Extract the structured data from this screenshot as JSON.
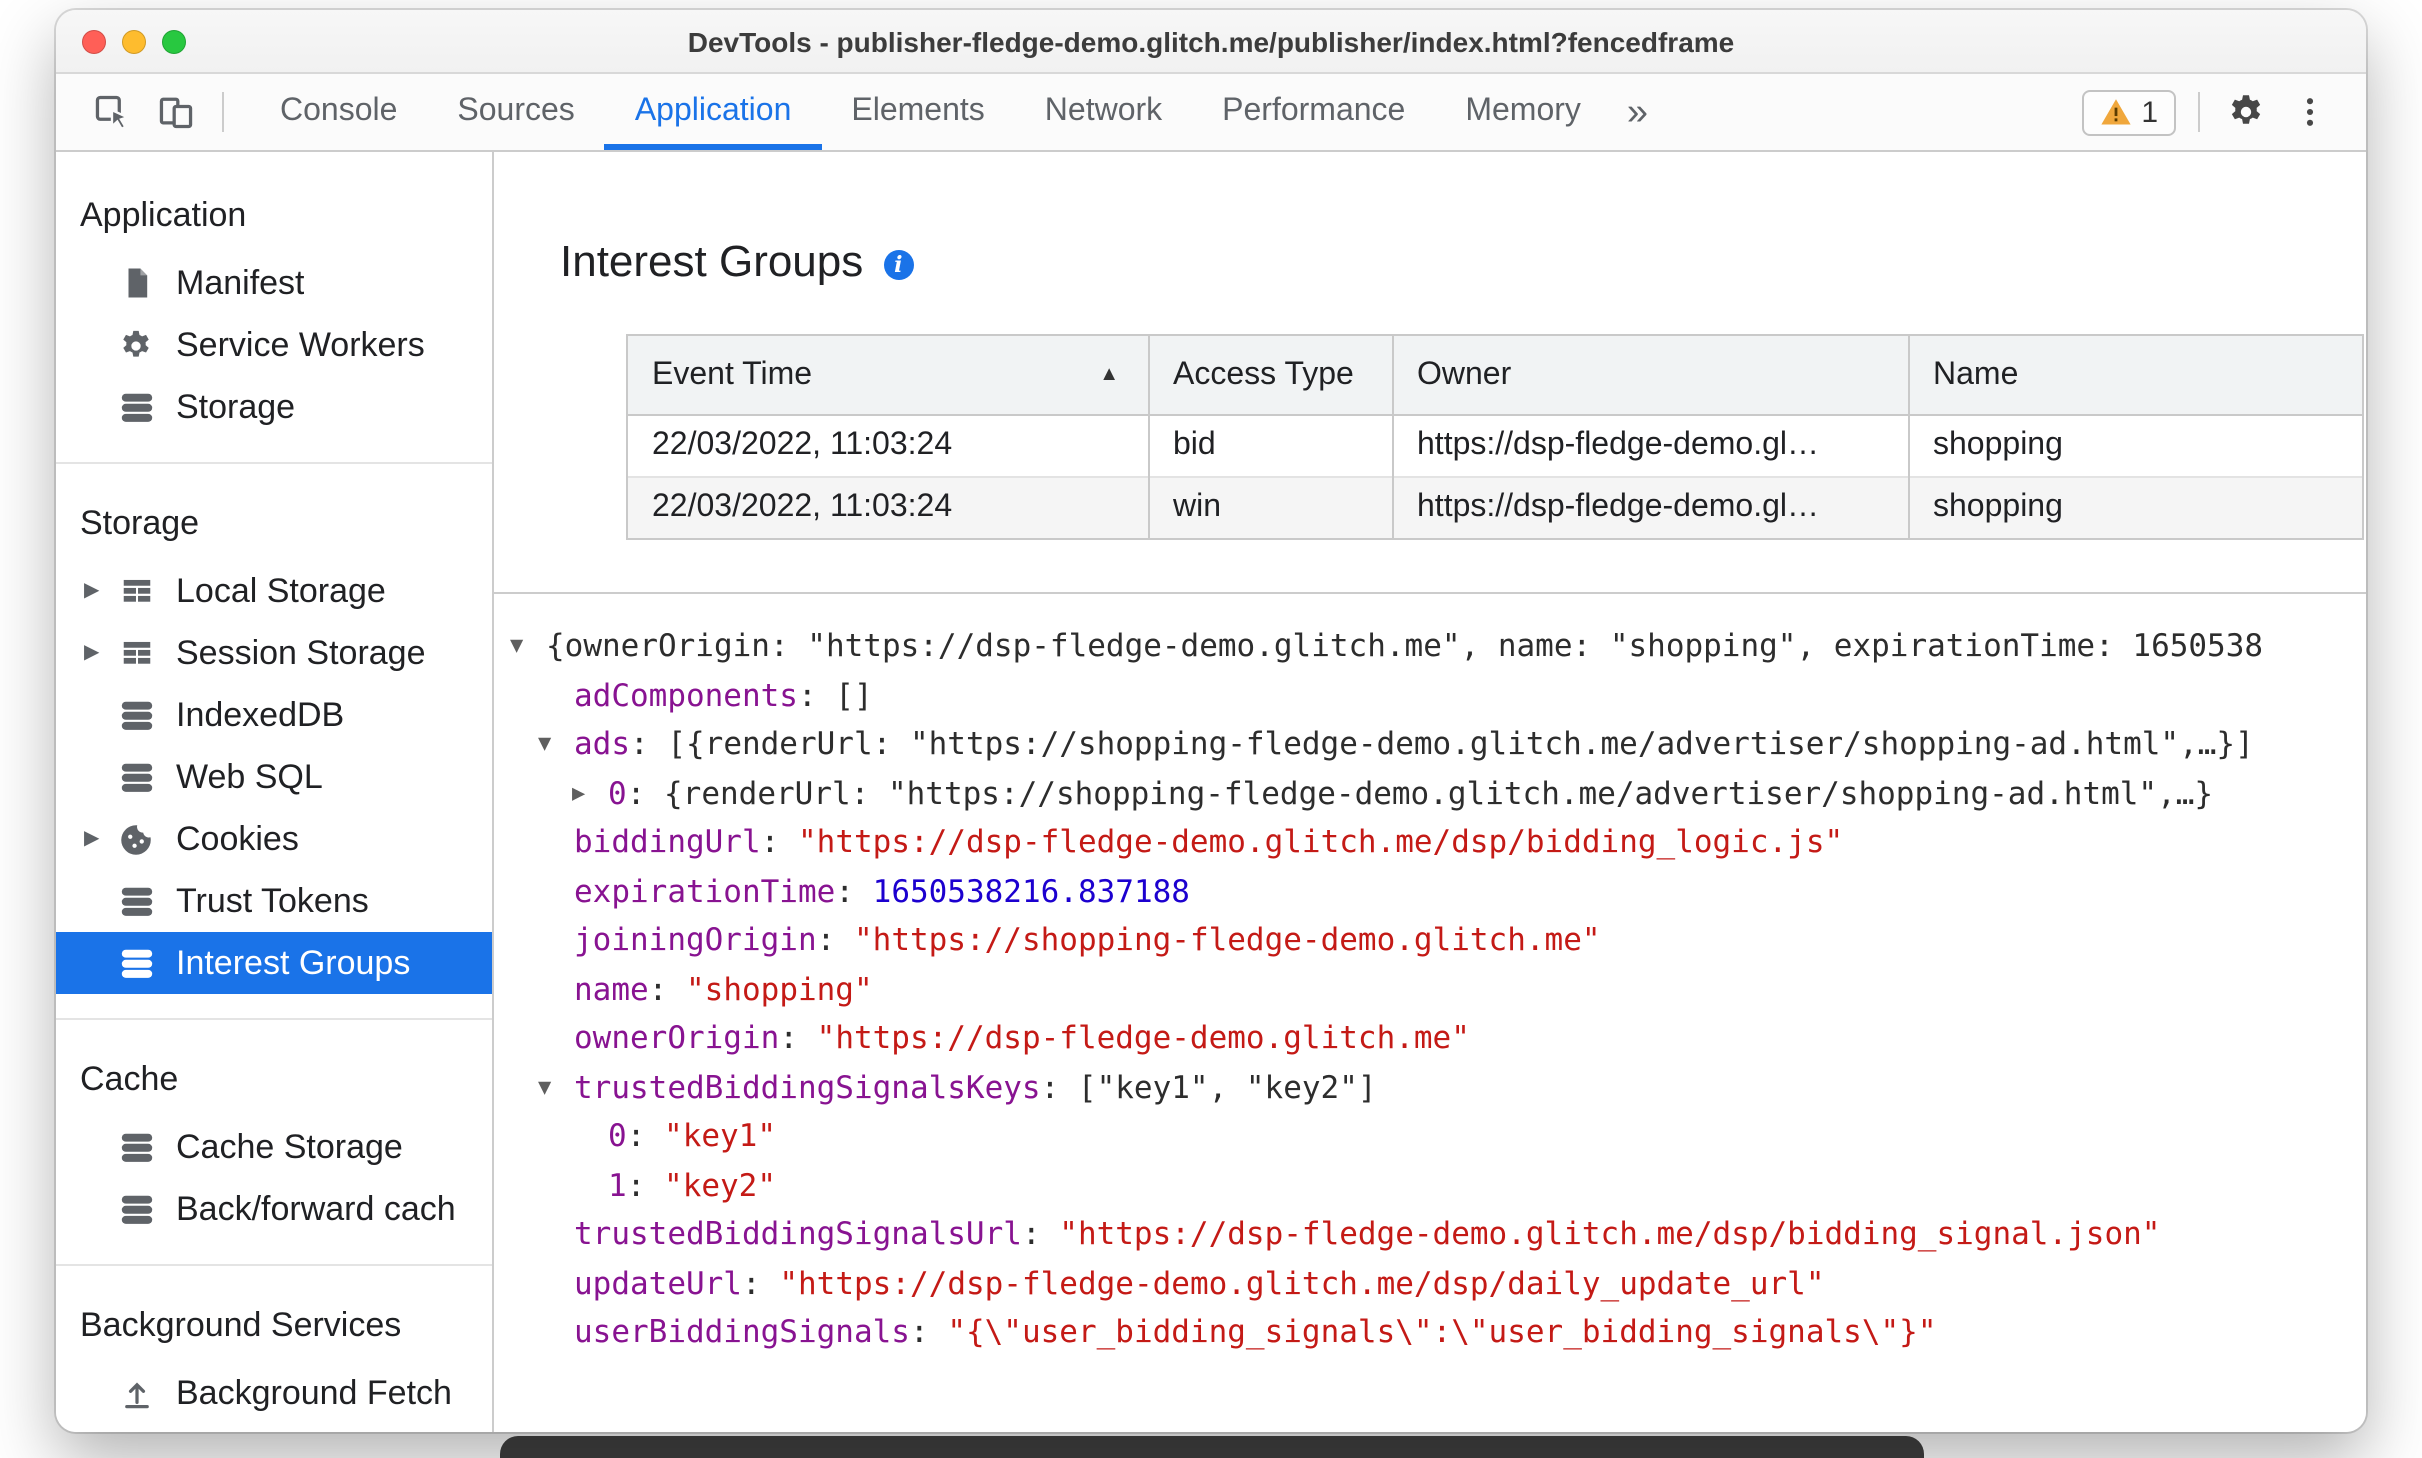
{
  "window": {
    "title": "DevTools - publisher-fledge-demo.glitch.me/publisher/index.html?fencedframe"
  },
  "toolbar": {
    "tabs": [
      {
        "label": "Console",
        "selected": false
      },
      {
        "label": "Sources",
        "selected": false
      },
      {
        "label": "Application",
        "selected": true
      },
      {
        "label": "Elements",
        "selected": false
      },
      {
        "label": "Network",
        "selected": false
      },
      {
        "label": "Performance",
        "selected": false
      },
      {
        "label": "Memory",
        "selected": false
      }
    ],
    "more_tabs_label": "»",
    "warning_count": "1"
  },
  "sidebar": {
    "sections": [
      {
        "title": "Application",
        "items": [
          {
            "label": "Manifest",
            "icon": "manifest-icon"
          },
          {
            "label": "Service Workers",
            "icon": "service-workers-icon"
          },
          {
            "label": "Storage",
            "icon": "database-icon"
          }
        ]
      },
      {
        "title": "Storage",
        "items": [
          {
            "label": "Local Storage",
            "icon": "table-icon",
            "expander": true
          },
          {
            "label": "Session Storage",
            "icon": "table-icon",
            "expander": true
          },
          {
            "label": "IndexedDB",
            "icon": "database-icon"
          },
          {
            "label": "Web SQL",
            "icon": "database-icon"
          },
          {
            "label": "Cookies",
            "icon": "cookie-icon",
            "expander": true
          },
          {
            "label": "Trust Tokens",
            "icon": "database-icon"
          },
          {
            "label": "Interest Groups",
            "icon": "database-icon",
            "selected": true
          }
        ]
      },
      {
        "title": "Cache",
        "items": [
          {
            "label": "Cache Storage",
            "icon": "database-icon"
          },
          {
            "label": "Back/forward cach",
            "icon": "database-icon"
          }
        ]
      },
      {
        "title": "Background Services",
        "items": [
          {
            "label": "Background Fetch",
            "icon": "background-fetch-icon"
          }
        ]
      }
    ]
  },
  "main": {
    "title": "Interest Groups",
    "table": {
      "columns": [
        "Event Time",
        "Access Type",
        "Owner",
        "Name"
      ],
      "sort": {
        "column": "Event Time",
        "direction": "asc"
      },
      "rows": [
        [
          "22/03/2022, 11:03:24",
          "bid",
          "https://dsp-fledge-demo.gl…",
          "shopping"
        ],
        [
          "22/03/2022, 11:03:24",
          "win",
          "https://dsp-fledge-demo.gl…",
          "shopping"
        ]
      ]
    },
    "details_tree": {
      "rows": [
        {
          "level": 0,
          "arrow": "expanded",
          "segments": [
            {
              "type": "plain",
              "text": "{ownerOrigin: \"https://dsp-fledge-demo.glitch.me\", name: \"shopping\", expirationTime: 1650538"
            }
          ]
        },
        {
          "level": 1,
          "arrow": null,
          "segments": [
            {
              "type": "key",
              "text": "adComponents"
            },
            {
              "type": "plain",
              "text": ": []"
            }
          ]
        },
        {
          "level": 1,
          "arrow": "expanded",
          "segments": [
            {
              "type": "key",
              "text": "ads"
            },
            {
              "type": "plain",
              "text": ": [{renderUrl: \"https://shopping-fledge-demo.glitch.me/advertiser/shopping-ad.html\",…}]"
            }
          ]
        },
        {
          "level": 2,
          "arrow": "collapsed",
          "segments": [
            {
              "type": "key",
              "text": "0"
            },
            {
              "type": "plain",
              "text": ": {renderUrl: \"https://shopping-fledge-demo.glitch.me/advertiser/shopping-ad.html\",…}"
            }
          ]
        },
        {
          "level": 1,
          "arrow": null,
          "segments": [
            {
              "type": "key",
              "text": "biddingUrl"
            },
            {
              "type": "plain",
              "text": ": "
            },
            {
              "type": "str",
              "text": "\"https://dsp-fledge-demo.glitch.me/dsp/bidding_logic.js\""
            }
          ]
        },
        {
          "level": 1,
          "arrow": null,
          "segments": [
            {
              "type": "key",
              "text": "expirationTime"
            },
            {
              "type": "plain",
              "text": ": "
            },
            {
              "type": "num",
              "text": "1650538216.837188"
            }
          ]
        },
        {
          "level": 1,
          "arrow": null,
          "segments": [
            {
              "type": "key",
              "text": "joiningOrigin"
            },
            {
              "type": "plain",
              "text": ": "
            },
            {
              "type": "str",
              "text": "\"https://shopping-fledge-demo.glitch.me\""
            }
          ]
        },
        {
          "level": 1,
          "arrow": null,
          "segments": [
            {
              "type": "key",
              "text": "name"
            },
            {
              "type": "plain",
              "text": ": "
            },
            {
              "type": "str",
              "text": "\"shopping\""
            }
          ]
        },
        {
          "level": 1,
          "arrow": null,
          "segments": [
            {
              "type": "key",
              "text": "ownerOrigin"
            },
            {
              "type": "plain",
              "text": ": "
            },
            {
              "type": "str",
              "text": "\"https://dsp-fledge-demo.glitch.me\""
            }
          ]
        },
        {
          "level": 1,
          "arrow": "expanded",
          "segments": [
            {
              "type": "key",
              "text": "trustedBiddingSignalsKeys"
            },
            {
              "type": "plain",
              "text": ": [\"key1\", \"key2\"]"
            }
          ]
        },
        {
          "level": 2,
          "arrow": null,
          "segments": [
            {
              "type": "key",
              "text": "0"
            },
            {
              "type": "plain",
              "text": ": "
            },
            {
              "type": "str",
              "text": "\"key1\""
            }
          ]
        },
        {
          "level": 2,
          "arrow": null,
          "segments": [
            {
              "type": "key",
              "text": "1"
            },
            {
              "type": "plain",
              "text": ": "
            },
            {
              "type": "str",
              "text": "\"key2\""
            }
          ]
        },
        {
          "level": 1,
          "arrow": null,
          "segments": [
            {
              "type": "key",
              "text": "trustedBiddingSignalsUrl"
            },
            {
              "type": "plain",
              "text": ": "
            },
            {
              "type": "str",
              "text": "\"https://dsp-fledge-demo.glitch.me/dsp/bidding_signal.json\""
            }
          ]
        },
        {
          "level": 1,
          "arrow": null,
          "segments": [
            {
              "type": "key",
              "text": "updateUrl"
            },
            {
              "type": "plain",
              "text": ": "
            },
            {
              "type": "str",
              "text": "\"https://dsp-fledge-demo.glitch.me/dsp/daily_update_url\""
            }
          ]
        },
        {
          "level": 1,
          "arrow": null,
          "segments": [
            {
              "type": "key",
              "text": "userBiddingSignals"
            },
            {
              "type": "plain",
              "text": ": "
            },
            {
              "type": "str",
              "text": "\"{\\\"user_bidding_signals\\\":\\\"user_bidding_signals\\\"}\""
            }
          ]
        }
      ]
    }
  },
  "colors": {
    "accent": "#1a73e8",
    "tree_key": "#881391",
    "tree_string": "#c41a16",
    "tree_number": "#1c00cf",
    "warning_orange": "#f0a73c"
  }
}
